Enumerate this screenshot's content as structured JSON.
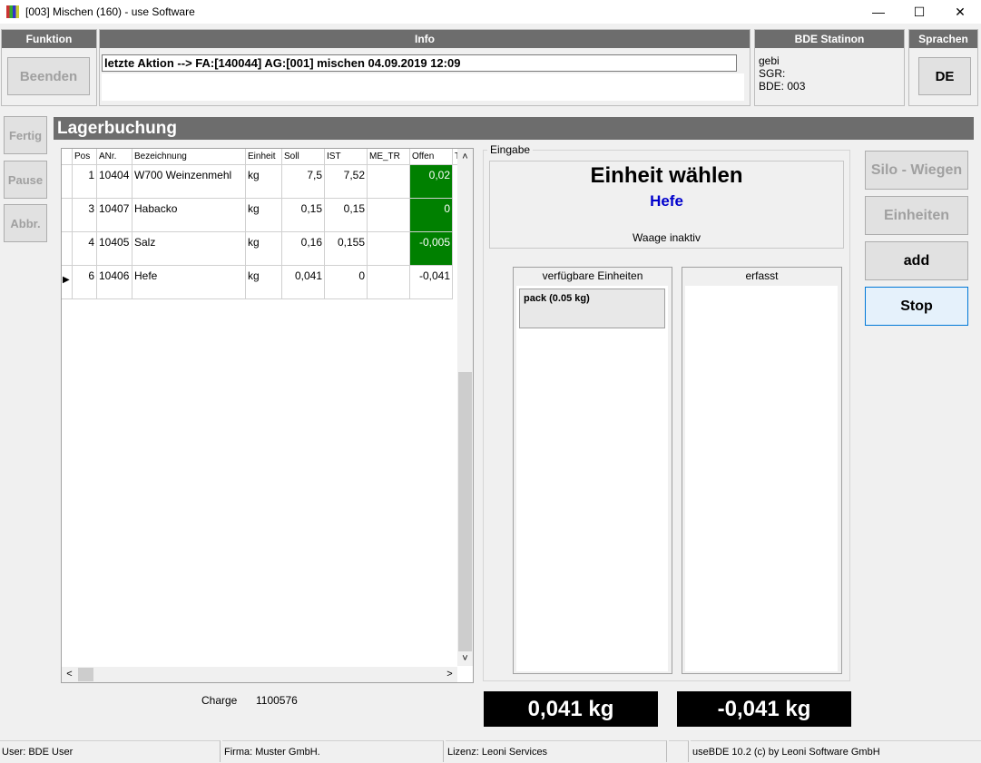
{
  "window": {
    "title": "[003] Mischen (160) - use Software",
    "min": "—",
    "max": "☐",
    "close": "✕"
  },
  "funktion": {
    "title": "Funktion",
    "beenden": "Beenden"
  },
  "info": {
    "title": "Info",
    "text": "letzte Aktion --> FA:[140044] AG:[001] mischen 04.09.2019 12:09"
  },
  "station": {
    "title": "BDE Statinon",
    "line1": "gebi",
    "line2": "SGR:",
    "line3": "BDE: 003"
  },
  "sprachen": {
    "title": "Sprachen",
    "lang": "DE"
  },
  "side": {
    "fertig": "Fertig",
    "pause": "Pause",
    "abbr": "Abbr."
  },
  "section_title": "Lagerbuchung",
  "grid": {
    "headers": [
      "Pos",
      "ANr.",
      "Bezeichnung",
      "Einheit",
      "Soll",
      "IST",
      "ME_TR",
      "Offen",
      "T"
    ],
    "rows": [
      {
        "pos": "1",
        "anr": "10404",
        "bez": "W700 Weinzenmehl",
        "einheit": "kg",
        "soll": "7,5",
        "ist": "7,52",
        "me_tr": "",
        "offen": "0,02"
      },
      {
        "pos": "3",
        "anr": "10407",
        "bez": "Habacko",
        "einheit": "kg",
        "soll": "0,15",
        "ist": "0,15",
        "me_tr": "",
        "offen": "0"
      },
      {
        "pos": "4",
        "anr": "10405",
        "bez": "Salz",
        "einheit": "kg",
        "soll": "0,16",
        "ist": "0,155",
        "me_tr": "",
        "offen": "-0,005"
      },
      {
        "pos": "6",
        "anr": "10406",
        "bez": "Hefe",
        "einheit": "kg",
        "soll": "0,041",
        "ist": "0",
        "me_tr": "",
        "offen": "-0,041"
      }
    ],
    "current_marker": "▶",
    "scroll_up": "˄",
    "scroll_down": "˅",
    "scroll_left": "<",
    "scroll_right": ">"
  },
  "charge": {
    "label": "Charge",
    "value": "1100576"
  },
  "eingabe": {
    "title": "Eingabe",
    "heading": "Einheit wählen",
    "item": "Hefe",
    "waage": "Waage inaktiv"
  },
  "verfuegbar": {
    "title": "verfügbare Einheiten",
    "items": [
      "pack (0.05 kg)"
    ]
  },
  "erfasst": {
    "title": "erfasst"
  },
  "buttons": {
    "silo": "Silo - Wiegen",
    "einheiten": "Einheiten",
    "add": "add",
    "stop": "Stop"
  },
  "displays": {
    "left": "0,041 kg",
    "right": "-0,041 kg"
  },
  "status": {
    "user": "User: BDE User",
    "firma": "Firma: Muster GmbH.",
    "lizenz": "Lizenz: Leoni Services",
    "version": "useBDE 10.2 (c) by Leoni Software GmbH"
  },
  "colors": {
    "header_gray": "#6d6d6d",
    "offen_ok": "#008000",
    "display_bg": "#000000",
    "item_blue": "#0000cc"
  }
}
